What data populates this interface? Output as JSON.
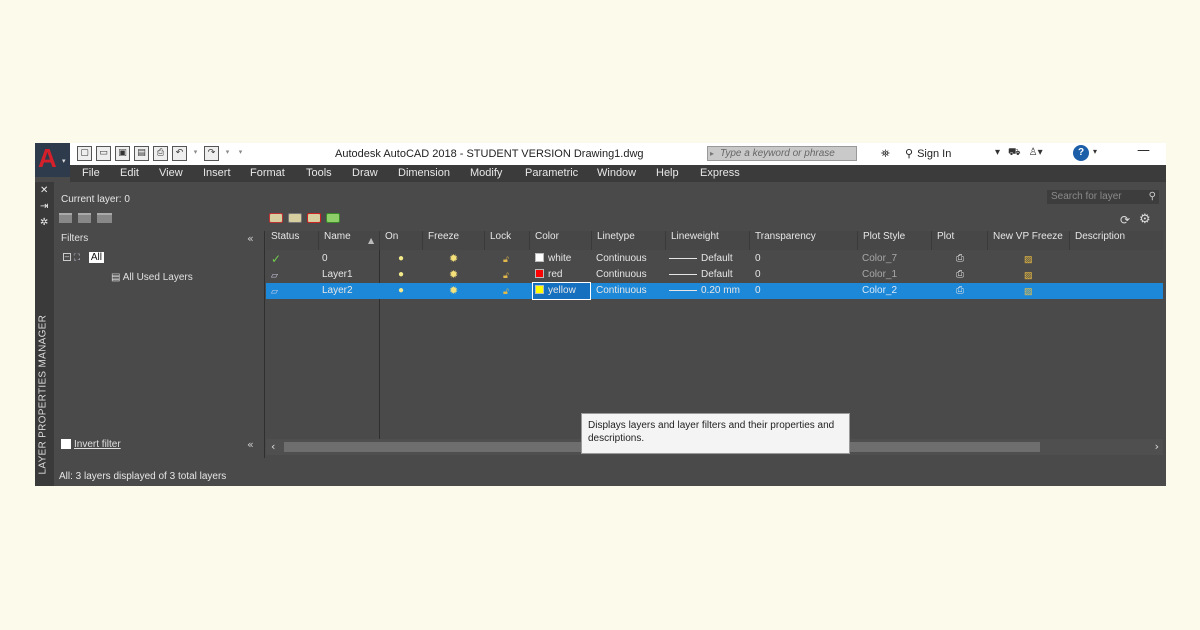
{
  "window": {
    "title": "Autodesk AutoCAD 2018 - STUDENT VERSION    Drawing1.dwg",
    "search_placeholder": "Type a keyword or phrase",
    "sign_in": "Sign In",
    "help": "?"
  },
  "menus": [
    "File",
    "Edit",
    "View",
    "Insert",
    "Format",
    "Tools",
    "Draw",
    "Dimension",
    "Modify",
    "Parametric",
    "Window",
    "Help",
    "Express"
  ],
  "palette": {
    "vertical_title": "LAYER PROPERTIES MANAGER",
    "current_layer": "Current layer: 0",
    "search_layer_placeholder": "Search for layer",
    "filters_header": "Filters",
    "tree_all": "All",
    "tree_used": "All Used Layers",
    "invert_filter": "Invert filter",
    "status_text": "All: 3 layers displayed of 3 total layers",
    "tooltip": "Displays layers and layer filters and their properties and descriptions."
  },
  "columns": [
    "Status",
    "Name",
    "On",
    "Freeze",
    "Lock",
    "Color",
    "Linetype",
    "Lineweight",
    "Transparency",
    "Plot Style",
    "Plot",
    "New VP Freeze",
    "Description"
  ],
  "layers": [
    {
      "status": "current",
      "name": "0",
      "color_name": "white",
      "color_hex": "#ffffff",
      "linetype": "Continuous",
      "lineweight": "Default",
      "transparency": "0",
      "plot_style": "Color_7",
      "selected": false
    },
    {
      "status": "layer",
      "name": "Layer1",
      "color_name": "red",
      "color_hex": "#ff0000",
      "linetype": "Continuous",
      "lineweight": "Default",
      "transparency": "0",
      "plot_style": "Color_1",
      "selected": false
    },
    {
      "status": "layer",
      "name": "Layer2",
      "color_name": "yellow",
      "color_hex": "#ffff00",
      "linetype": "Continuous",
      "lineweight": "0.20 mm",
      "transparency": "0",
      "plot_style": "Color_2",
      "selected": true
    }
  ],
  "colors": {
    "selection": "#1d88d8",
    "palette_bg": "#4a4a4a",
    "logo_red": "#d3202a"
  }
}
